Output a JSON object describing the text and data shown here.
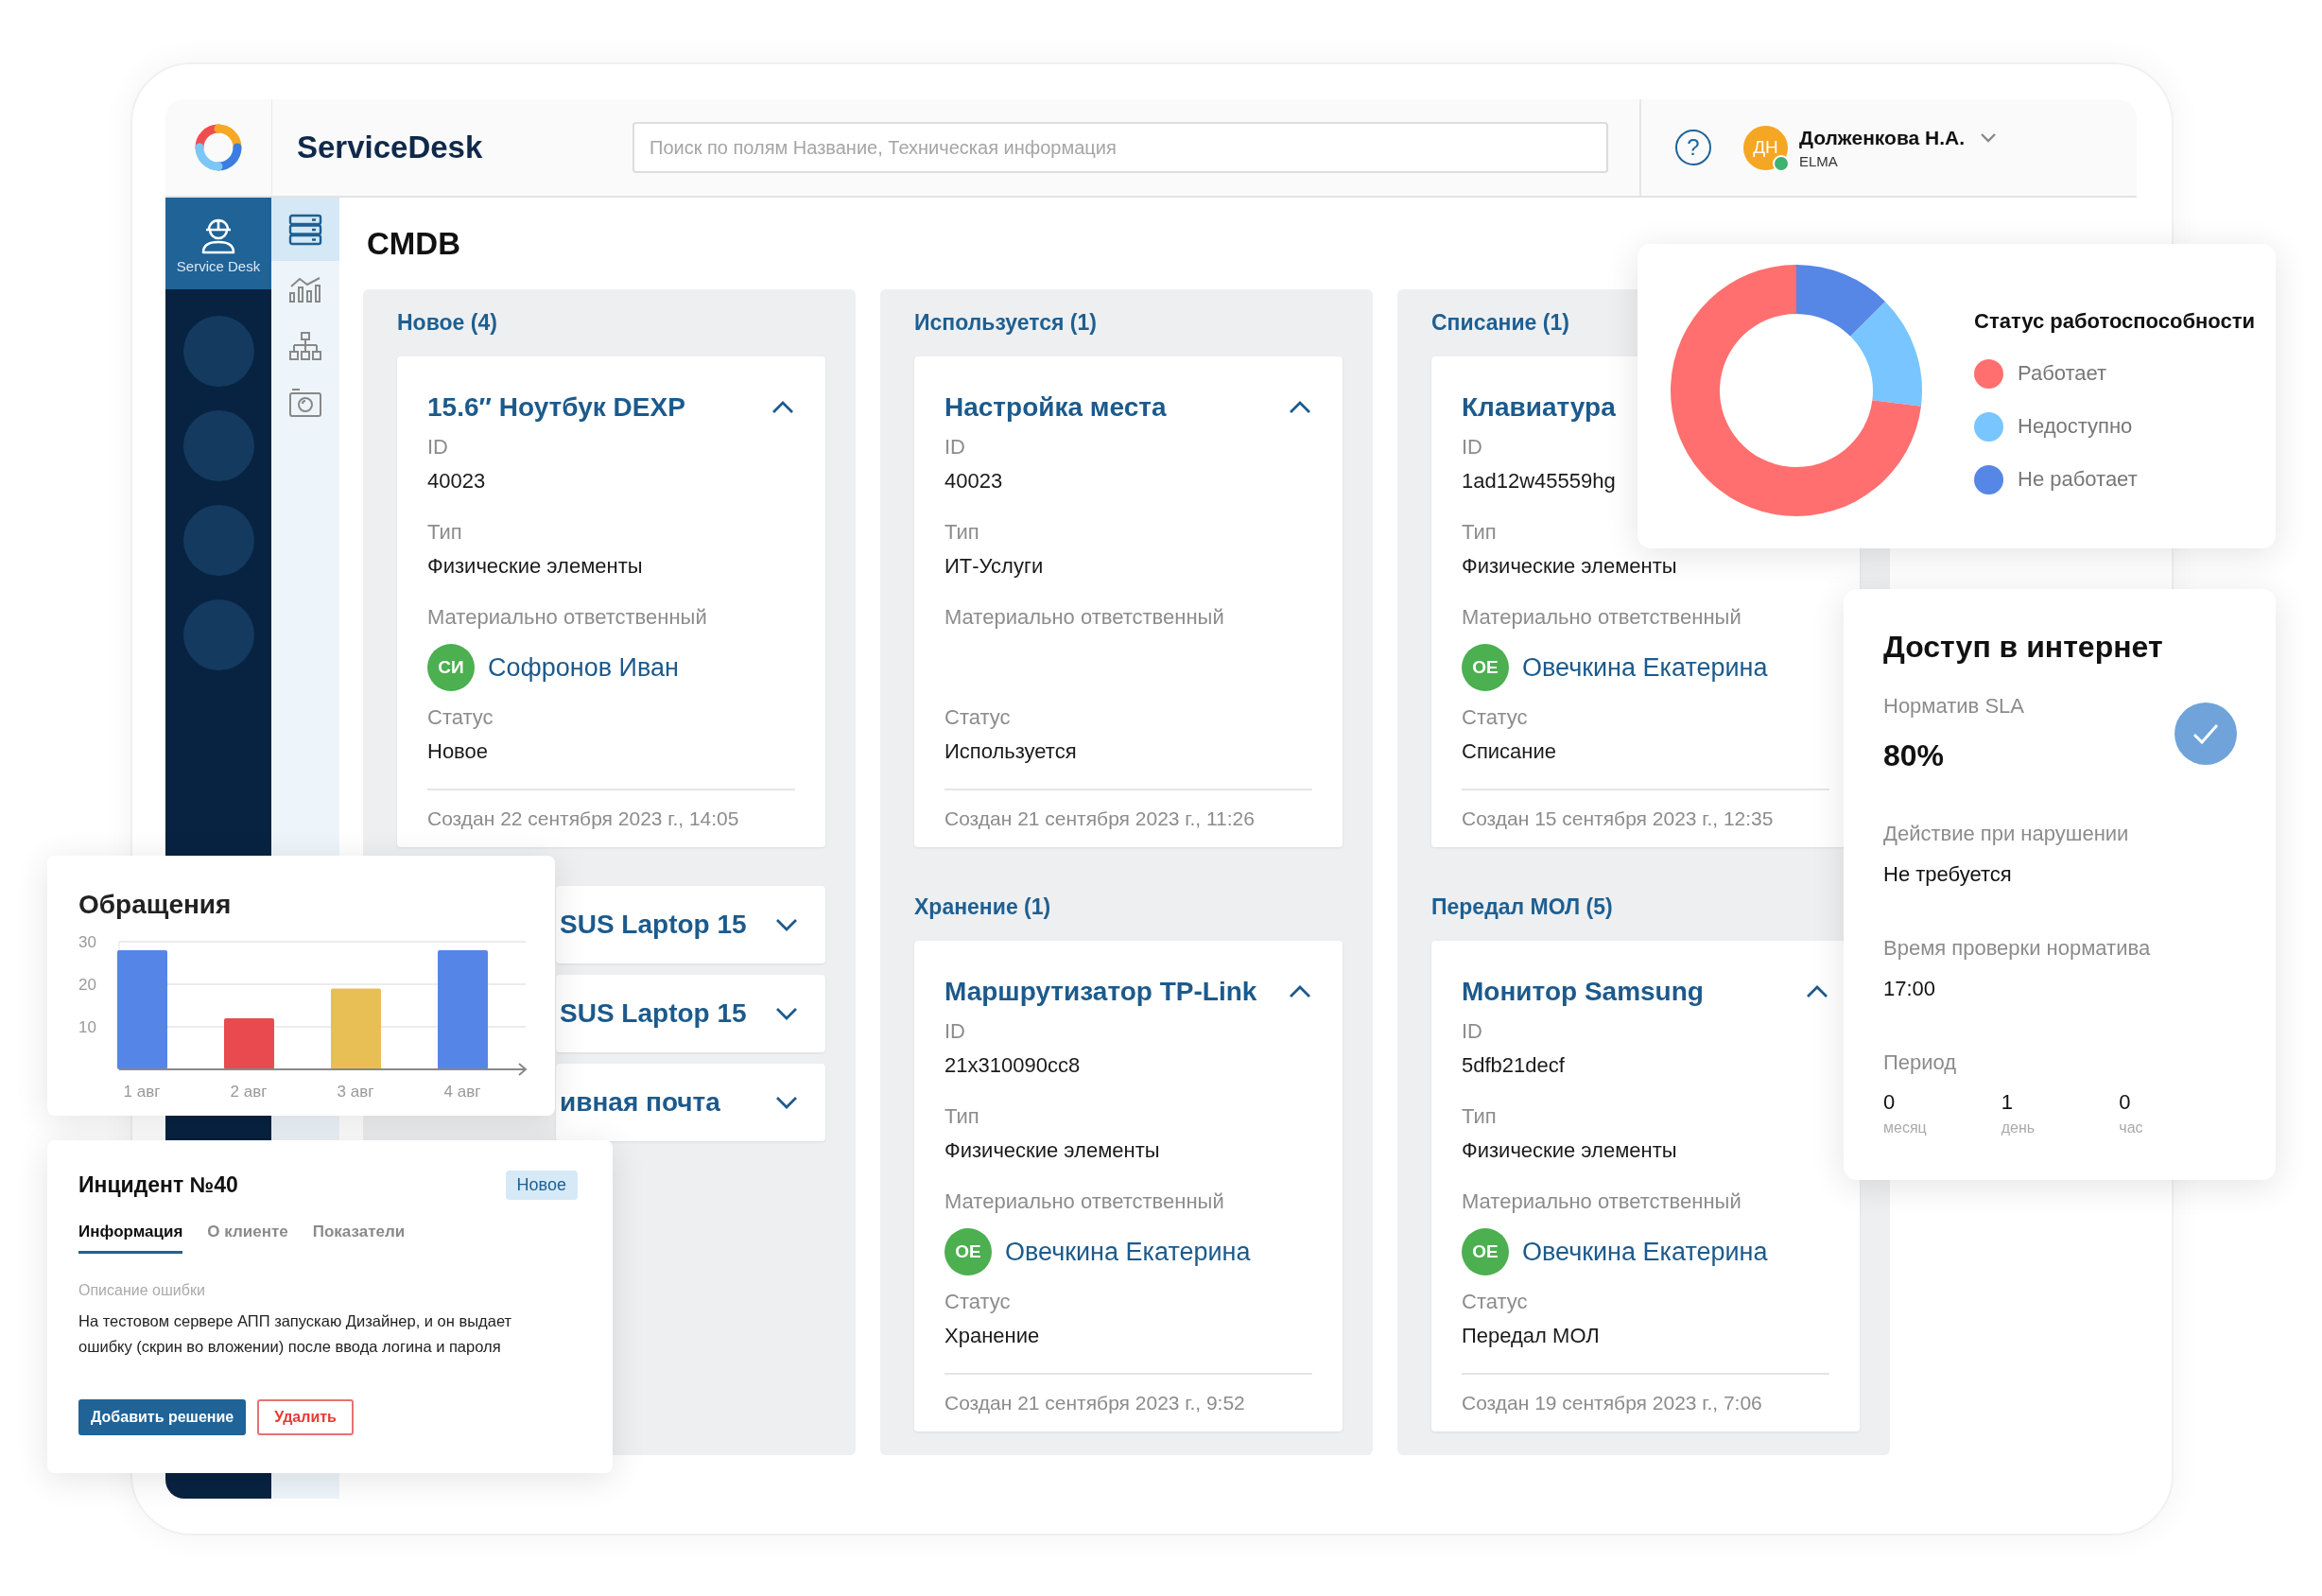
{
  "header": {
    "title": "ServiceDesk",
    "search": {
      "placeholder": "Поиск по полям Название, Техническая информация"
    },
    "help": "?",
    "user": {
      "initials": "ДН",
      "name": "Долженкова Н.А.",
      "org": "ELMA",
      "online": true
    }
  },
  "sidebar": {
    "items": [
      {
        "kind": "app",
        "label": "Service Desk",
        "selected": true
      },
      {
        "kind": "placeholder",
        "selected": false
      },
      {
        "kind": "placeholder",
        "selected": false
      },
      {
        "kind": "placeholder",
        "selected": false
      },
      {
        "kind": "placeholder",
        "selected": false
      }
    ]
  },
  "rail": {
    "items": [
      {
        "selected": true
      },
      {
        "selected": false
      },
      {
        "selected": false
      },
      {
        "selected": false
      }
    ]
  },
  "page_title": "CMDB",
  "columns": [
    {
      "groups": [
        {
          "title": "Новое (4)",
          "cards": [
            {
              "title": "15.6″ Ноутбук DEXP",
              "expanded": true,
              "fields": [
                {
                  "label": "ID",
                  "value": "40023"
                },
                {
                  "label": "Тип",
                  "value": "Физические элементы"
                },
                {
                  "kind": "person",
                  "label": "Материально ответственный",
                  "person": {
                    "initials": "СИ",
                    "name": "Софронов Иван"
                  }
                },
                {
                  "label": "Статус",
                  "value": "Новое"
                }
              ],
              "created": "Создан 22 сентября 2023 г., 14:05"
            },
            {
              "title": "SUS Laptop 15",
              "expanded": false
            },
            {
              "title": "SUS Laptop 15",
              "expanded": false
            },
            {
              "title": "ивная почта",
              "expanded": false
            }
          ]
        }
      ]
    },
    {
      "groups": [
        {
          "title": "Используется (1)",
          "cards": [
            {
              "title": "Настройка места",
              "expanded": true,
              "fields": [
                {
                  "label": "ID",
                  "value": "40023"
                },
                {
                  "label": "Тип",
                  "value": "ИТ-Услуги"
                },
                {
                  "kind": "person",
                  "label": "Материально ответственный"
                },
                {
                  "label": "Статус",
                  "value": "Используется"
                }
              ],
              "created": "Создан 21 сентября 2023 г., 11:26"
            }
          ]
        },
        {
          "title": "Хранение (1)",
          "cards": [
            {
              "title": "Маршрутизатор TP-Link",
              "expanded": true,
              "fields": [
                {
                  "label": "ID",
                  "value": "21x310090cc8"
                },
                {
                  "label": "Тип",
                  "value": "Физические элементы"
                },
                {
                  "kind": "person",
                  "label": "Материально ответственный",
                  "person": {
                    "initials": "ОЕ",
                    "name": "Овечкина Екатерина"
                  }
                },
                {
                  "label": "Статус",
                  "value": "Хранение"
                }
              ],
              "created": "Создан 21 сентября 2023 г., 9:52"
            }
          ]
        }
      ]
    },
    {
      "groups": [
        {
          "title": "Списание (1)",
          "cards": [
            {
              "title": "Клавиатура",
              "expanded": true,
              "fields": [
                {
                  "label": "ID",
                  "value": "1ad12w45559hg"
                },
                {
                  "label": "Тип",
                  "value": "Физические элементы"
                },
                {
                  "kind": "person",
                  "label": "Материально ответственный",
                  "person": {
                    "initials": "ОЕ",
                    "name": "Овечкина Екатерина"
                  }
                },
                {
                  "label": "Статус",
                  "value": "Списание"
                }
              ],
              "created": "Создан 15 сентября 2023 г., 12:35"
            }
          ]
        },
        {
          "title": "Передал МОЛ (5)",
          "cards": [
            {
              "title": "Монитор Samsung",
              "expanded": true,
              "fields": [
                {
                  "label": "ID",
                  "value": "5dfb21decf"
                },
                {
                  "label": "Тип",
                  "value": "Физические элементы"
                },
                {
                  "kind": "person",
                  "label": "Материально ответственный",
                  "person": {
                    "initials": "ОЕ",
                    "name": "Овечкина Екатерина"
                  }
                },
                {
                  "label": "Статус",
                  "value": "Передал МОЛ"
                }
              ],
              "created": "Создан 19 сентября 2023 г., 7:06"
            }
          ]
        }
      ]
    }
  ],
  "chart_panel": {
    "chart_data": {
      "type": "bar",
      "title": "Обращения",
      "categories": [
        "1 авг",
        "2 авг",
        "3 авг",
        "4 авг"
      ],
      "ylim": [
        0,
        30
      ],
      "yticks": [
        10,
        20,
        30
      ],
      "stacked": true,
      "series": [
        {
          "color": "#5585e6",
          "values": [
            28,
            null,
            null,
            28
          ]
        },
        {
          "color": "#e84a4f",
          "values": [
            null,
            12,
            null,
            null
          ]
        },
        {
          "color": "#e8bf55",
          "values": [
            null,
            null,
            19,
            null
          ]
        }
      ]
    }
  },
  "incident": {
    "title": "Инцидент №40",
    "badge": "Новое",
    "tabs": [
      {
        "label": "Информация",
        "selected": true
      },
      {
        "label": "О клиенте",
        "selected": false
      },
      {
        "label": "Показатели",
        "selected": false
      }
    ],
    "field_label": "Описание ошибки",
    "description": "На тестовом сервере АПП запускаю Дизайнер, и он выдает ошибку (скрин во вложении) после ввода логина и пароля",
    "buttons": [
      {
        "label": "Добавить решение",
        "kind": "primary"
      },
      {
        "label": "Удалить",
        "kind": "danger"
      }
    ]
  },
  "status_panel": {
    "title": "Статус работоспособности",
    "legend": [
      {
        "label": "Работает",
        "color": "#ff6f6f"
      },
      {
        "label": "Недоступно",
        "color": "#79c5ff"
      },
      {
        "label": "Не работает",
        "color": "#5686e6"
      }
    ]
  },
  "sla": {
    "title": "Доступ в интернет",
    "norm_label": "Норматив SLA",
    "norm": "80%",
    "fields": [
      {
        "label": "Действие при нарушении",
        "value": "Не требуется"
      },
      {
        "label": "Время проверки норматива",
        "value": "17:00"
      }
    ],
    "period": {
      "label": "Период",
      "items": [
        {
          "value": "0",
          "unit": "месяц"
        },
        {
          "value": "1",
          "unit": "день"
        },
        {
          "value": "0",
          "unit": "час"
        }
      ]
    }
  }
}
